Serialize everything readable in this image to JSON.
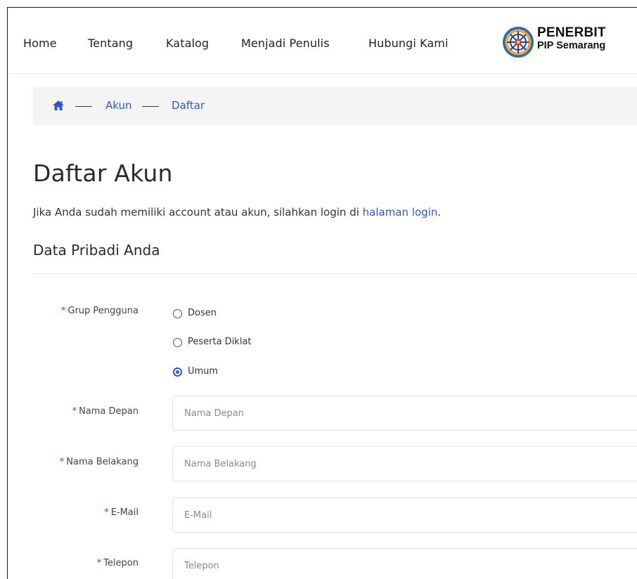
{
  "nav": {
    "items": [
      {
        "label": "Home"
      },
      {
        "label": "Tentang"
      },
      {
        "label": "Katalog"
      },
      {
        "label": "Menjadi Penulis"
      },
      {
        "label": "Hubungi Kami"
      }
    ],
    "logo": {
      "line1": "PENERBIT",
      "line2": "PIP Semarang",
      "icon": "ship-wheel-emblem"
    }
  },
  "breadcrumb": {
    "home_icon": "home-icon",
    "items": [
      {
        "label": "Akun"
      },
      {
        "label": "Daftar"
      }
    ]
  },
  "page": {
    "title": "Daftar Akun",
    "intro_text": "Jika Anda sudah memiliki account atau akun, silahkan login di ",
    "intro_link": "halaman login",
    "intro_end": ".",
    "section_title": "Data Pribadi Anda"
  },
  "form": {
    "required_mark": "*",
    "group": {
      "label": "Grup Pengguna",
      "options": [
        {
          "label": "Dosen",
          "checked": false
        },
        {
          "label": "Peserta Diklat",
          "checked": false
        },
        {
          "label": "Umum",
          "checked": true
        }
      ]
    },
    "fields": [
      {
        "label": "Nama Depan",
        "placeholder": "Nama Depan",
        "value": ""
      },
      {
        "label": "Nama Belakang",
        "placeholder": "Nama Belakang",
        "value": ""
      },
      {
        "label": "E-Mail",
        "placeholder": "E-Mail",
        "value": ""
      },
      {
        "label": "Telepon",
        "placeholder": "Telepon",
        "value": ""
      }
    ]
  },
  "colors": {
    "link": "#2f55d4",
    "required": "#e02424",
    "breadcrumb_bg": "#f4f4f4"
  }
}
